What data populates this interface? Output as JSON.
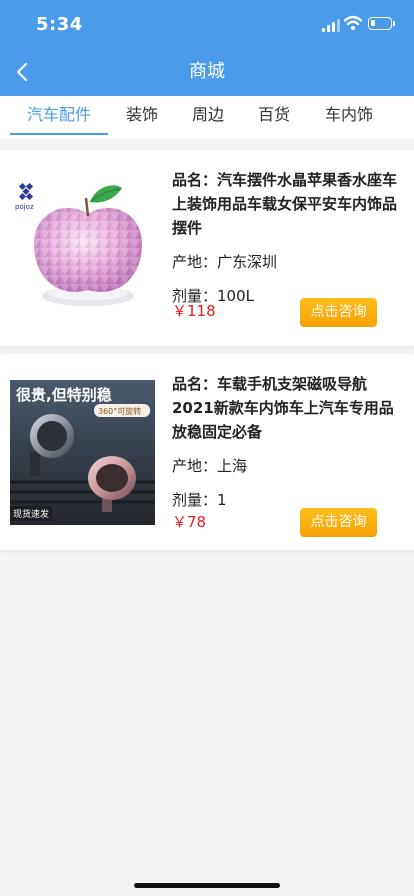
{
  "status": {
    "time": "5:34"
  },
  "nav": {
    "title": "商城"
  },
  "tabs": [
    {
      "label": "汽车配件"
    },
    {
      "label": "装饰"
    },
    {
      "label": "周边"
    },
    {
      "label": "百货"
    },
    {
      "label": "车内饰"
    }
  ],
  "products": [
    {
      "name_label": "品名：",
      "name": "汽车摆件水晶苹果香水座车上装饰用品车载女保平安车内饰品摆件",
      "origin_label": "产地：",
      "origin": "广东深圳",
      "qty_label": "剂量：",
      "qty": "100L",
      "price": "￥118",
      "button": "点击咨询",
      "image_brand": "pojoz"
    },
    {
      "name_label": "品名：",
      "name": "车载手机支架磁吸导航2021新款车内饰车上汽车专用品放稳固定必备",
      "origin_label": "产地：",
      "origin": "上海",
      "qty_label": "剂量：",
      "qty": "1",
      "price": "￥78",
      "button": "点击咨询",
      "image_headline": "很贵,但特别稳",
      "image_badge": "360°可旋转",
      "image_tag": "现货速发"
    }
  ],
  "colors": {
    "primary": "#4a9bea",
    "price": "#e81d1d",
    "button": "#f7a100"
  }
}
